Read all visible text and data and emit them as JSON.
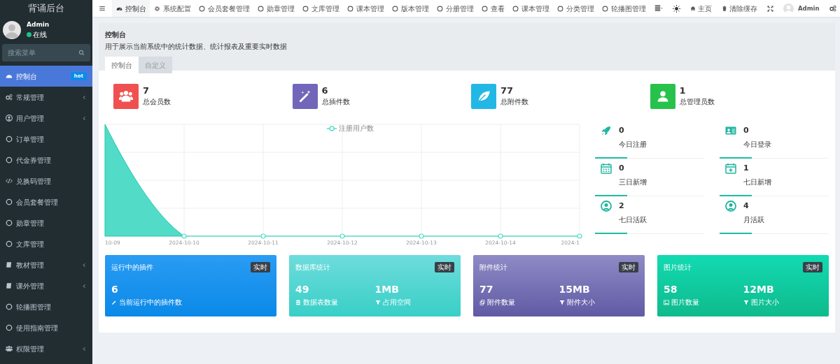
{
  "sidebar": {
    "brand": "背诵后台",
    "user": {
      "name": "Admin",
      "status": "在线",
      "online": true
    },
    "search": {
      "placeholder": "搜索菜单"
    },
    "items": [
      {
        "label": "控制台",
        "selected": true,
        "badge": "hot",
        "has_submenu": false
      },
      {
        "label": "常规管理",
        "selected": false,
        "has_submenu": true
      },
      {
        "label": "用户管理",
        "selected": false,
        "has_submenu": true
      },
      {
        "label": "订单管理",
        "selected": false,
        "has_submenu": false
      },
      {
        "label": "代金券管理",
        "selected": false,
        "has_submenu": false
      },
      {
        "label": "兑换码管理",
        "selected": false,
        "has_submenu": false
      },
      {
        "label": "会员套餐管理",
        "selected": false,
        "has_submenu": false
      },
      {
        "label": "勋章管理",
        "selected": false,
        "has_submenu": false
      },
      {
        "label": "文库管理",
        "selected": false,
        "has_submenu": false
      },
      {
        "label": "教材管理",
        "selected": false,
        "has_submenu": true
      },
      {
        "label": "课外管理",
        "selected": false,
        "has_submenu": true
      },
      {
        "label": "轮播图管理",
        "selected": false,
        "has_submenu": false
      },
      {
        "label": "使用指南管理",
        "selected": false,
        "has_submenu": false
      },
      {
        "label": "权限管理",
        "selected": false,
        "has_submenu": true
      }
    ]
  },
  "topnav": {
    "tabs": [
      {
        "label": "控制台",
        "selected": true
      },
      {
        "label": "系统配置",
        "selected": false
      },
      {
        "label": "会员套餐管理",
        "selected": false
      },
      {
        "label": "勋章管理",
        "selected": false
      },
      {
        "label": "文库管理",
        "selected": false
      },
      {
        "label": "课本管理",
        "selected": false
      },
      {
        "label": "版本管理",
        "selected": false
      },
      {
        "label": "分册管理",
        "selected": false
      },
      {
        "label": "查看",
        "selected": false
      },
      {
        "label": "课本管理",
        "selected": false
      },
      {
        "label": "分类管理",
        "selected": false
      },
      {
        "label": "轮播图管理",
        "selected": false
      }
    ],
    "home": "主页",
    "clear_cache": "清除缓存",
    "user": "Admin"
  },
  "page": {
    "title": "控制台",
    "description": "用于展示当前系统中的统计数据、统计报表及重要实时数据",
    "tabs": [
      {
        "label": "控制台",
        "selected": true
      },
      {
        "label": "自定义",
        "selected": false
      }
    ]
  },
  "stats": [
    {
      "value": "7",
      "label": "总会员数",
      "color": "#f05050"
    },
    {
      "value": "6",
      "label": "总插件数",
      "color": "#7266ba"
    },
    {
      "value": "77",
      "label": "总附件数",
      "color": "#23b7e5"
    },
    {
      "value": "1",
      "label": "总管理员数",
      "color": "#27c24c"
    }
  ],
  "chart": {
    "legend": "注册用户数",
    "x_labels": [
      "10-09",
      "2024-10-10",
      "2024-10-11",
      "2024-10-12",
      "2024-10-13",
      "2024-10-14",
      "2024-1"
    ]
  },
  "mini_stats": [
    {
      "value": "0",
      "label": "今日注册"
    },
    {
      "value": "0",
      "label": "今日登录"
    },
    {
      "value": "0",
      "label": "三日新增"
    },
    {
      "value": "1",
      "label": "七日新增"
    },
    {
      "value": "2",
      "label": "七日活跃"
    },
    {
      "value": "4",
      "label": "月活跃"
    }
  ],
  "cards": [
    {
      "title": "运行中的插件",
      "badge": "实时",
      "metrics": [
        {
          "value": "6",
          "label": "当前运行中的插件数"
        }
      ]
    },
    {
      "title": "数据库统计",
      "badge": "实时",
      "metrics": [
        {
          "value": "49",
          "label": "数据表数量"
        },
        {
          "value": "1MB",
          "label": "占用空间"
        }
      ]
    },
    {
      "title": "附件统计",
      "badge": "实时",
      "metrics": [
        {
          "value": "77",
          "label": "附件数量"
        },
        {
          "value": "15MB",
          "label": "附件大小"
        }
      ]
    },
    {
      "title": "图片统计",
      "badge": "实时",
      "metrics": [
        {
          "value": "58",
          "label": "图片数量"
        },
        {
          "value": "12MB",
          "label": "图片大小"
        }
      ]
    }
  ]
}
